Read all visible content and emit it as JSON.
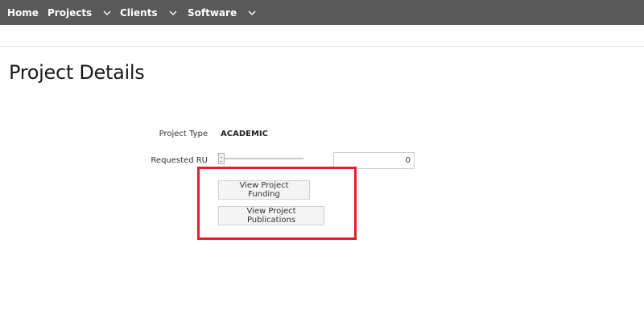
{
  "nav": {
    "items": [
      {
        "label": "Home",
        "has_dropdown": false
      },
      {
        "label": "Projects",
        "has_dropdown": true
      },
      {
        "label": "Clients",
        "has_dropdown": true
      },
      {
        "label": "Software",
        "has_dropdown": true
      }
    ],
    "background_color": "#595959"
  },
  "page": {
    "title": "Project Details"
  },
  "form": {
    "project_type_label": "Project Type",
    "project_type_value": "ACADEMIC",
    "requested_ru_label": "Requested RU",
    "requested_ru_value": "0",
    "requested_ru_slider_fraction": 0
  },
  "buttons": {
    "view_funding": "View Project Funding",
    "view_publications": "View Project Publications"
  },
  "annotation": {
    "highlight_color": "#e02028"
  }
}
